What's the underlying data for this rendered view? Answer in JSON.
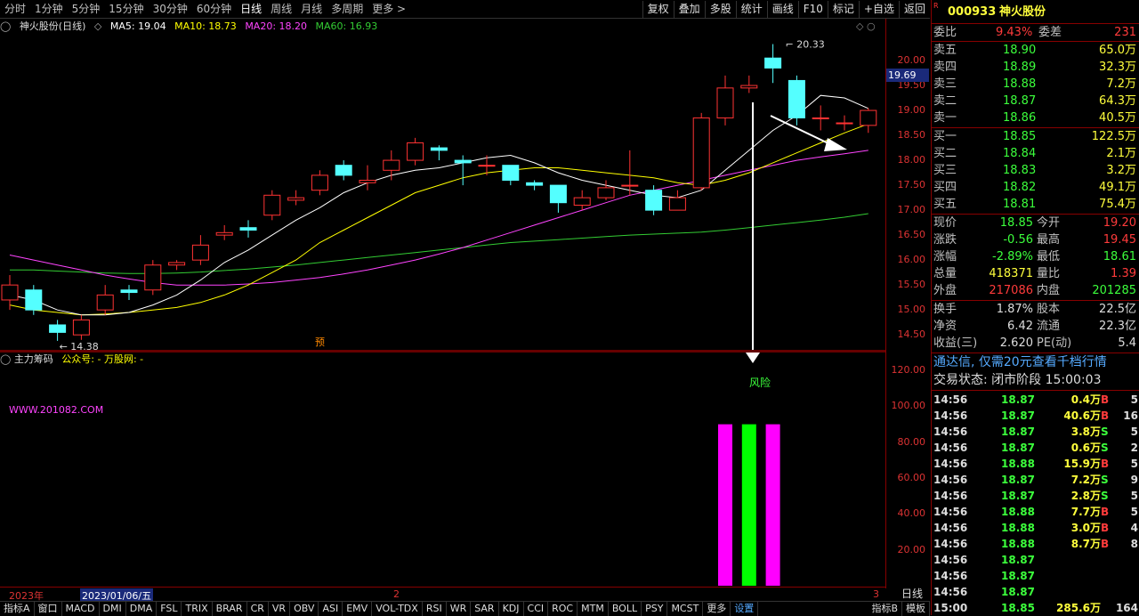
{
  "toolbar": {
    "periods": [
      "分时",
      "1分钟",
      "5分钟",
      "15分钟",
      "30分钟",
      "60分钟",
      "日线",
      "周线",
      "月线",
      "多周期",
      "更多 >"
    ],
    "selected": "日线",
    "buttons": [
      "复权",
      "叠加",
      "多股",
      "统计",
      "画线",
      "F10",
      "标记",
      "+自选",
      "返回"
    ]
  },
  "chart_title": {
    "stock": "神火股份(日线)",
    "ma5": "MA5: 19.04",
    "ma10": "MA10: 18.73",
    "ma20": "MA20: 18.20",
    "ma60": "MA60: 16.93",
    "colors": {
      "ma5": "#ffffff",
      "ma10": "#ffff00",
      "ma20": "#ff44ff",
      "ma60": "#33cc33"
    }
  },
  "price_axis": {
    "labels": [
      "20.00",
      "19.50",
      "19.00",
      "18.50",
      "18.00",
      "17.50",
      "17.00",
      "16.50",
      "16.00",
      "15.50",
      "15.00",
      "14.50"
    ],
    "current": "19.69"
  },
  "annotations": {
    "high": "20.33",
    "low": "14.38",
    "pre": "预",
    "risk": "风险"
  },
  "indicator": {
    "name": "主力筹码",
    "wechat": "公众号: - 万股网: -",
    "url": "WWW.201082.COM",
    "axis": [
      "120.00",
      "100.00",
      "80.00",
      "60.00",
      "40.00",
      "20.00"
    ]
  },
  "dates": {
    "year": "2023年",
    "current": "2023/01/06/五",
    "m2": "2",
    "m3": "3"
  },
  "day_label": "日线",
  "tabs": [
    "指标A",
    "窗口",
    "MACD",
    "DMI",
    "DMA",
    "FSL",
    "TRIX",
    "BRAR",
    "CR",
    "VR",
    "OBV",
    "ASI",
    "EMV",
    "VOL-TDX",
    "RSI",
    "WR",
    "SAR",
    "KDJ",
    "CCI",
    "ROC",
    "MTM",
    "BOLL",
    "PSY",
    "MCST",
    "更多",
    "设置"
  ],
  "tabs_right": [
    "指标B",
    "模板"
  ],
  "quote": {
    "code": "000933",
    "name": "神火股份",
    "weibi_label": "委比",
    "weibi": "9.43%",
    "weicha_label": "委差",
    "weicha": "231",
    "asks": [
      {
        "label": "卖五",
        "price": "18.90",
        "vol": "65.0万"
      },
      {
        "label": "卖四",
        "price": "18.89",
        "vol": "32.3万"
      },
      {
        "label": "卖三",
        "price": "18.88",
        "vol": "7.2万"
      },
      {
        "label": "卖二",
        "price": "18.87",
        "vol": "64.3万"
      },
      {
        "label": "卖一",
        "price": "18.86",
        "vol": "40.5万"
      }
    ],
    "bids": [
      {
        "label": "买一",
        "price": "18.85",
        "vol": "122.5万"
      },
      {
        "label": "买二",
        "price": "18.84",
        "vol": "2.1万"
      },
      {
        "label": "买三",
        "price": "18.83",
        "vol": "3.2万"
      },
      {
        "label": "买四",
        "price": "18.82",
        "vol": "49.1万"
      },
      {
        "label": "买五",
        "price": "18.81",
        "vol": "75.4万"
      }
    ],
    "stats": [
      {
        "l1": "现价",
        "v1": "18.85",
        "c1": "grn",
        "l2": "今开",
        "v2": "19.20",
        "c2": "red"
      },
      {
        "l1": "涨跌",
        "v1": "-0.56",
        "c1": "grn",
        "l2": "最高",
        "v2": "19.45",
        "c2": "red"
      },
      {
        "l1": "涨幅",
        "v1": "-2.89%",
        "c1": "grn",
        "l2": "最低",
        "v2": "18.61",
        "c2": "grn"
      },
      {
        "l1": "总量",
        "v1": "418371",
        "c1": "yel",
        "l2": "量比",
        "v2": "1.39",
        "c2": "red"
      },
      {
        "l1": "外盘",
        "v1": "217086",
        "c1": "red",
        "l2": "内盘",
        "v2": "201285",
        "c2": "grn"
      }
    ],
    "stats2": [
      {
        "l1": "换手",
        "v1": "1.87%",
        "l2": "股本",
        "v2": "22.5亿"
      },
      {
        "l1": "净资",
        "v1": "6.42",
        "l2": "流通",
        "v2": "22.3亿"
      },
      {
        "l1": "收益(三)",
        "v1": "2.620",
        "l2": "PE(动)",
        "v2": "5.4"
      }
    ],
    "ad": "通达信, 仅需20元查看千档行情",
    "status": "交易状态: 闭市阶段 15:00:03"
  },
  "ticks": [
    {
      "t": "14:56",
      "p": "18.87",
      "v": "0.4万",
      "s": "B",
      "n": "5"
    },
    {
      "t": "14:56",
      "p": "18.87",
      "v": "40.6万",
      "s": "B",
      "n": "16"
    },
    {
      "t": "14:56",
      "p": "18.87",
      "v": "3.8万",
      "s": "S",
      "n": "5"
    },
    {
      "t": "14:56",
      "p": "18.87",
      "v": "0.6万",
      "s": "S",
      "n": "2"
    },
    {
      "t": "14:56",
      "p": "18.88",
      "v": "15.9万",
      "s": "B",
      "n": "5"
    },
    {
      "t": "14:56",
      "p": "18.87",
      "v": "7.2万",
      "s": "S",
      "n": "9"
    },
    {
      "t": "14:56",
      "p": "18.87",
      "v": "2.8万",
      "s": "S",
      "n": "5"
    },
    {
      "t": "14:56",
      "p": "18.88",
      "v": "7.7万",
      "s": "B",
      "n": "5"
    },
    {
      "t": "14:56",
      "p": "18.88",
      "v": "3.0万",
      "s": "B",
      "n": "4"
    },
    {
      "t": "14:56",
      "p": "18.88",
      "v": "8.7万",
      "s": "B",
      "n": "8"
    },
    {
      "t": "14:56",
      "p": "18.87",
      "v": "",
      "s": "",
      "n": ""
    },
    {
      "t": "14:56",
      "p": "18.87",
      "v": "",
      "s": "",
      "n": ""
    },
    {
      "t": "14:56",
      "p": "18.87",
      "v": "",
      "s": "",
      "n": ""
    },
    {
      "t": "15:00",
      "p": "18.85",
      "v": "285.6万",
      "s": "",
      "n": "164"
    }
  ],
  "chart_data": {
    "type": "candlestick",
    "ylim": [
      14.2,
      20.5
    ],
    "candles": [
      {
        "o": 15.2,
        "c": 15.5,
        "h": 15.7,
        "l": 15.0
      },
      {
        "o": 15.4,
        "c": 15.0,
        "h": 15.5,
        "l": 14.9
      },
      {
        "o": 14.7,
        "c": 14.55,
        "h": 14.8,
        "l": 14.38
      },
      {
        "o": 14.5,
        "c": 14.8,
        "h": 14.9,
        "l": 14.4
      },
      {
        "o": 15.0,
        "c": 15.3,
        "h": 15.5,
        "l": 14.9
      },
      {
        "o": 15.4,
        "c": 15.35,
        "h": 15.5,
        "l": 15.2
      },
      {
        "o": 15.4,
        "c": 15.9,
        "h": 16.0,
        "l": 15.3
      },
      {
        "o": 15.9,
        "c": 15.95,
        "h": 16.0,
        "l": 15.8
      },
      {
        "o": 16.0,
        "c": 16.3,
        "h": 16.5,
        "l": 15.9
      },
      {
        "o": 16.5,
        "c": 16.55,
        "h": 16.7,
        "l": 16.4
      },
      {
        "o": 16.65,
        "c": 16.6,
        "h": 16.8,
        "l": 16.45
      },
      {
        "o": 16.9,
        "c": 17.3,
        "h": 17.4,
        "l": 16.8
      },
      {
        "o": 17.2,
        "c": 17.25,
        "h": 17.4,
        "l": 17.1
      },
      {
        "o": 17.4,
        "c": 17.7,
        "h": 17.8,
        "l": 17.3
      },
      {
        "o": 17.9,
        "c": 17.7,
        "h": 18.0,
        "l": 17.6
      },
      {
        "o": 17.55,
        "c": 17.6,
        "h": 17.9,
        "l": 17.4
      },
      {
        "o": 17.8,
        "c": 18.0,
        "h": 18.2,
        "l": 17.6
      },
      {
        "o": 18.0,
        "c": 18.35,
        "h": 18.45,
        "l": 17.9
      },
      {
        "o": 18.25,
        "c": 18.2,
        "h": 18.3,
        "l": 18.0
      },
      {
        "o": 18.0,
        "c": 17.95,
        "h": 18.1,
        "l": 17.5
      },
      {
        "o": 17.9,
        "c": 17.9,
        "h": 18.1,
        "l": 17.7
      },
      {
        "o": 17.9,
        "c": 17.6,
        "h": 17.9,
        "l": 17.5
      },
      {
        "o": 17.55,
        "c": 17.5,
        "h": 17.6,
        "l": 17.4
      },
      {
        "o": 17.5,
        "c": 17.15,
        "h": 17.5,
        "l": 16.95
      },
      {
        "o": 17.1,
        "c": 17.25,
        "h": 17.4,
        "l": 17.0
      },
      {
        "o": 17.25,
        "c": 17.45,
        "h": 17.6,
        "l": 17.2
      },
      {
        "o": 17.5,
        "c": 17.5,
        "h": 18.2,
        "l": 17.3
      },
      {
        "o": 17.4,
        "c": 17.0,
        "h": 17.5,
        "l": 16.9
      },
      {
        "o": 17.0,
        "c": 17.25,
        "h": 17.4,
        "l": 17.0
      },
      {
        "o": 17.45,
        "c": 18.85,
        "h": 18.95,
        "l": 17.4
      },
      {
        "o": 18.85,
        "c": 19.45,
        "h": 19.7,
        "l": 18.7
      },
      {
        "o": 19.45,
        "c": 19.5,
        "h": 19.7,
        "l": 19.35
      },
      {
        "o": 20.05,
        "c": 19.85,
        "h": 20.33,
        "l": 19.55
      },
      {
        "o": 19.6,
        "c": 18.85,
        "h": 19.7,
        "l": 18.7
      },
      {
        "o": 18.85,
        "c": 18.85,
        "h": 19.1,
        "l": 18.6
      },
      {
        "o": 18.75,
        "c": 18.75,
        "h": 18.9,
        "l": 18.6
      },
      {
        "o": 18.7,
        "c": 19.0,
        "h": 19.05,
        "l": 18.55
      }
    ],
    "ma5": [
      15.3,
      15.2,
      15.0,
      14.9,
      14.9,
      14.95,
      15.1,
      15.3,
      15.6,
      15.95,
      16.2,
      16.5,
      16.8,
      17.05,
      17.35,
      17.55,
      17.7,
      17.8,
      17.85,
      17.95,
      18.05,
      18.1,
      17.95,
      17.75,
      17.6,
      17.5,
      17.4,
      17.3,
      17.25,
      17.4,
      17.8,
      18.2,
      18.6,
      18.9,
      19.3,
      19.25,
      19.04
    ],
    "ma10": [
      15.1,
      15.0,
      14.95,
      14.9,
      14.92,
      14.95,
      15.0,
      15.05,
      15.15,
      15.3,
      15.5,
      15.75,
      16.0,
      16.35,
      16.6,
      16.85,
      17.1,
      17.35,
      17.5,
      17.65,
      17.75,
      17.8,
      17.85,
      17.85,
      17.8,
      17.75,
      17.7,
      17.65,
      17.55,
      17.5,
      17.6,
      17.75,
      17.95,
      18.15,
      18.35,
      18.55,
      18.73
    ],
    "ma20": [
      16.1,
      16.0,
      15.9,
      15.8,
      15.7,
      15.62,
      15.55,
      15.5,
      15.5,
      15.5,
      15.52,
      15.55,
      15.6,
      15.65,
      15.72,
      15.8,
      15.9,
      16.0,
      16.12,
      16.25,
      16.4,
      16.55,
      16.7,
      16.85,
      17.0,
      17.15,
      17.3,
      17.4,
      17.5,
      17.6,
      17.7,
      17.8,
      17.9,
      18.0,
      18.07,
      18.13,
      18.2
    ],
    "ma60": [
      15.8,
      15.8,
      15.78,
      15.76,
      15.74,
      15.73,
      15.73,
      15.74,
      15.76,
      15.79,
      15.82,
      15.86,
      15.9,
      15.95,
      16.0,
      16.05,
      16.1,
      16.15,
      16.2,
      16.25,
      16.3,
      16.35,
      16.38,
      16.41,
      16.44,
      16.47,
      16.5,
      16.52,
      16.54,
      16.56,
      16.6,
      16.65,
      16.7,
      16.75,
      16.8,
      16.86,
      16.93
    ],
    "indicator_bars": [
      {
        "index": 30,
        "value": 90,
        "color": "#ff00ff"
      },
      {
        "index": 31,
        "value": 90,
        "color": "#00ff00"
      },
      {
        "index": 32,
        "value": 90,
        "color": "#ff00ff"
      }
    ],
    "indicator_ylim": [
      0,
      130
    ]
  }
}
